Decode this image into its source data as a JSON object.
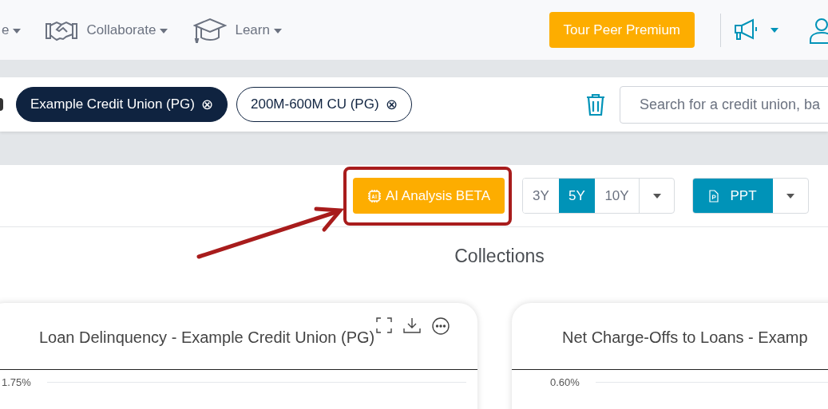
{
  "nav": {
    "items": [
      {
        "label": "e"
      },
      {
        "label": "Collaborate"
      },
      {
        "label": "Learn"
      }
    ],
    "premium_button": "Tour Peer Premium"
  },
  "filters": {
    "chips": [
      {
        "label": "Example Credit Union (PG)",
        "selected": true
      },
      {
        "label": "200M-600M CU (PG)",
        "selected": false
      }
    ],
    "remove_glyph": "⊗",
    "search": {
      "placeholder": "Search for a credit union, ba"
    }
  },
  "toolbar": {
    "ai_button": {
      "label": "AI Analysis",
      "badge": "BETA"
    },
    "periods": [
      {
        "label": "3Y",
        "selected": false
      },
      {
        "label": "5Y",
        "selected": true
      },
      {
        "label": "10Y",
        "selected": false
      }
    ],
    "export_button": "PPT"
  },
  "section_title": "Collections",
  "cards": [
    {
      "title": "Loan Delinquency - Example Credit Union (PG)",
      "y_tick": "1.75%",
      "tools": true
    },
    {
      "title": "Net Charge-Offs to Loans - Examp",
      "y_tick": "0.60%",
      "tools": false
    }
  ]
}
